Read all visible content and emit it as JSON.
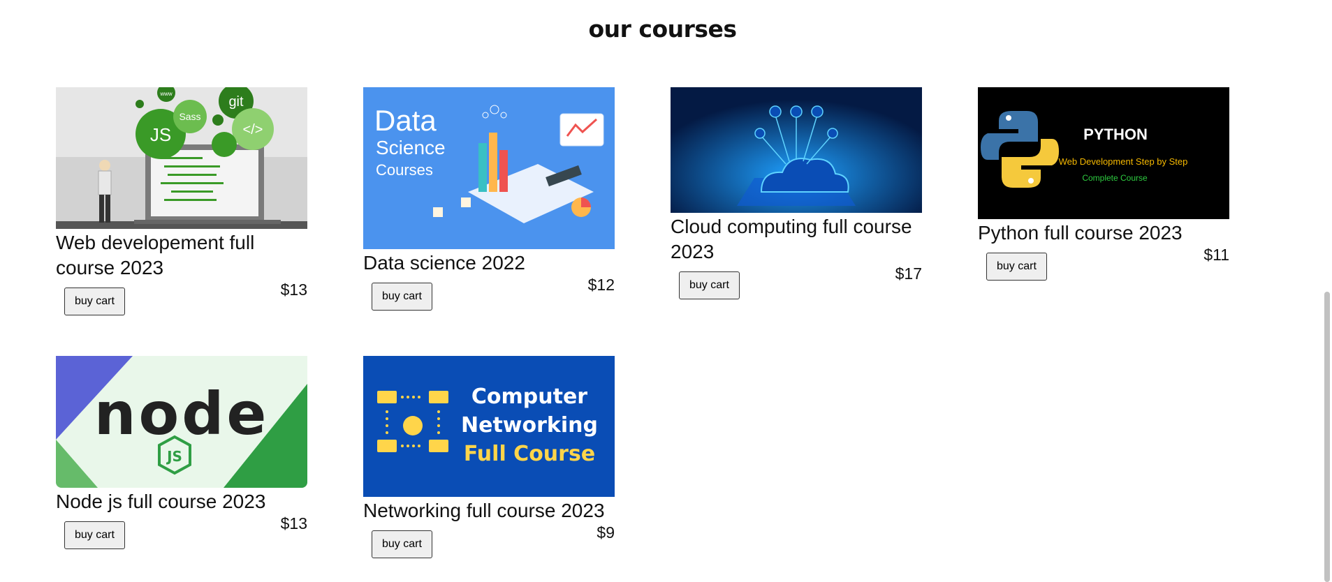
{
  "page": {
    "title": "our courses"
  },
  "courses": [
    {
      "name": "Web developement full course 2023",
      "price": "$13",
      "button": "buy cart",
      "thumb_text": {
        "a": "JS",
        "b": "Sass",
        "c": "git",
        "d": "</>",
        "e": "www"
      }
    },
    {
      "name": "Data science 2022",
      "price": "$12",
      "button": "buy cart",
      "thumb_text": {
        "a": "Data",
        "b": "Science",
        "c": "Courses"
      }
    },
    {
      "name": "Cloud computing full course 2023",
      "price": "$17",
      "button": "buy cart"
    },
    {
      "name": "Python full course 2023",
      "price": "$11",
      "button": "buy cart",
      "thumb_text": {
        "a": "PYTHON",
        "b": "Web Development Step by Step",
        "c": "Complete Course"
      }
    },
    {
      "name": "Node js full course 2023",
      "price": "$13",
      "button": "buy cart",
      "thumb_text": {
        "a": "node",
        "b": "JS"
      }
    },
    {
      "name": "Networking full course 2023",
      "price": "$9",
      "button": "buy cart",
      "thumb_text": {
        "a": "Computer",
        "b": "Networking",
        "c": "Full Course"
      }
    }
  ],
  "colors": {
    "web_green": "#3a9a27",
    "data_blue": "#4b93ee",
    "cloud_navy": "#06245a",
    "python_bg": "#000000",
    "python_yellow": "#f5b800",
    "node_green": "#2f9e44",
    "net_blue": "#0a4db5",
    "net_yellow": "#ffd54a"
  },
  "scrollbar": {
    "position": 0.5
  }
}
